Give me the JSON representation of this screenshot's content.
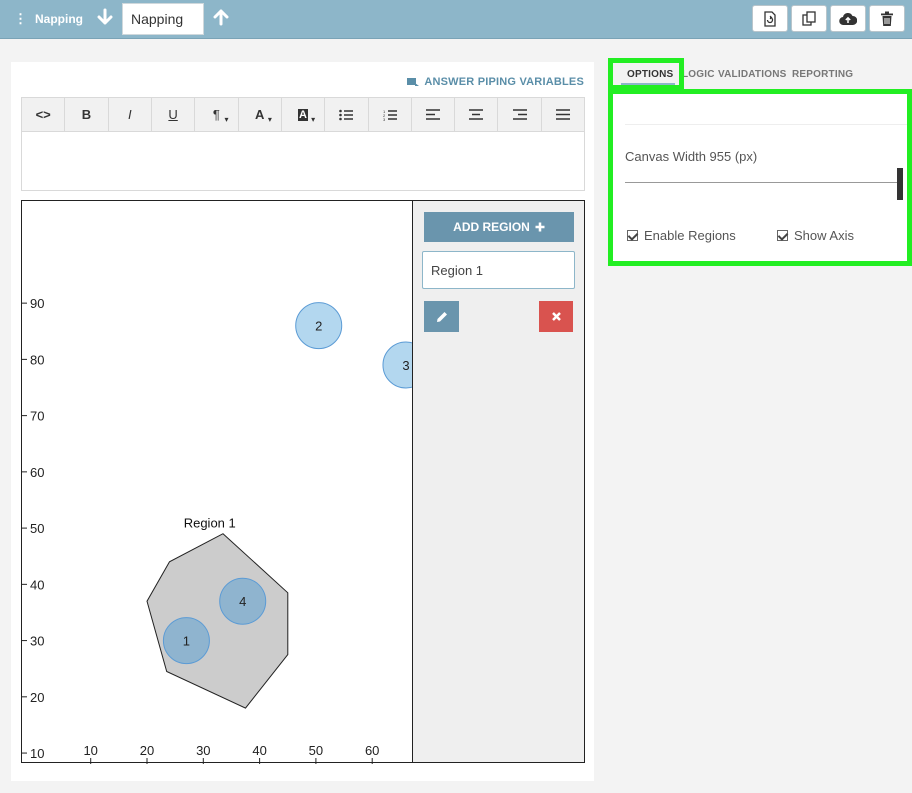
{
  "topbar": {
    "name": "Napping",
    "input_value": "Napping",
    "buttons": [
      "refresh-doc-icon",
      "copy-icon",
      "cloud-upload-icon",
      "trash-icon"
    ]
  },
  "editor": {
    "piping_label": "ANSWER PIPING VARIABLES",
    "toolbar": [
      "<>",
      "B",
      "I",
      "U",
      "¶",
      "A",
      "A",
      "list-ul",
      "list-ol",
      "align-left",
      "align-center",
      "align-right",
      "justify"
    ]
  },
  "chart_data": {
    "type": "scatter",
    "x_ticks": [
      "10",
      "20",
      "30",
      "40",
      "50",
      "60"
    ],
    "y_ticks": [
      "10",
      "20",
      "30",
      "40",
      "50",
      "60",
      "70",
      "80",
      "90"
    ],
    "points": [
      {
        "label": "1",
        "x": 27,
        "y": 30,
        "in_region": true
      },
      {
        "label": "2",
        "x": 50.5,
        "y": 86,
        "in_region": false
      },
      {
        "label": "3",
        "x": 66,
        "y": 79,
        "in_region": false
      },
      {
        "label": "4",
        "x": 37,
        "y": 37,
        "in_region": true
      }
    ],
    "regions": [
      {
        "name": "Region 1",
        "polygon": [
          [
            33.5,
            49
          ],
          [
            45,
            38.5
          ],
          [
            45,
            27.5
          ],
          [
            37.5,
            18
          ],
          [
            23.5,
            24.5
          ],
          [
            20,
            37
          ],
          [
            24,
            44
          ]
        ]
      }
    ],
    "colors": {
      "point_in_region": "#8fb4cf",
      "point_out": "#b3d7ef",
      "region_fill": "#cccccc"
    }
  },
  "region_panel": {
    "add_label": "ADD REGION",
    "region_input_value": "Region 1"
  },
  "options": {
    "tabs": [
      "OPTIONS",
      "LOGIC",
      "VALIDATIONS",
      "REPORTING"
    ],
    "canvas_width_label": "Canvas Width 955 (px)",
    "enable_regions_label": "Enable Regions",
    "show_axis_label": "Show Axis",
    "enable_regions_checked": true,
    "show_axis_checked": true
  },
  "colors": {
    "topbar": "#8db6c9",
    "accent": "#6a95ad",
    "danger": "#d9534f",
    "highlight": "#22ee22"
  }
}
